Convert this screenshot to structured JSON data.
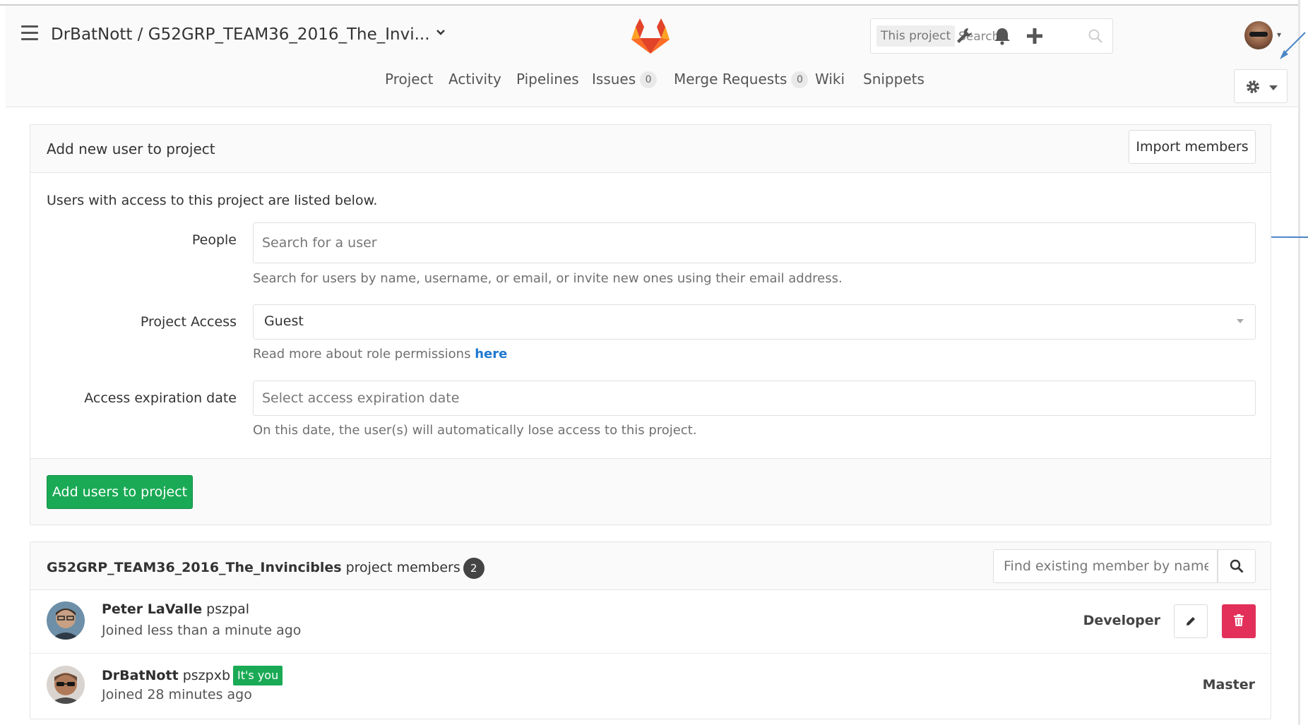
{
  "header": {
    "project_path": "DrBatNott / G52GRP_TEAM36_2016_The_Invi...",
    "search_scope": "This project",
    "search_placeholder": "Search"
  },
  "nav": {
    "items": [
      {
        "label": "Project"
      },
      {
        "label": "Activity"
      },
      {
        "label": "Pipelines"
      },
      {
        "label": "Issues",
        "count": "0"
      },
      {
        "label": "Merge Requests",
        "count": "0"
      },
      {
        "label": "Wiki"
      },
      {
        "label": "Snippets"
      }
    ]
  },
  "add_panel": {
    "title": "Add new user to project",
    "import_button": "Import members",
    "intro": "Users with access to this project are listed below.",
    "people_label": "People",
    "people_placeholder": "Search for a user",
    "people_help": "Search for users by name, username, or email, or invite new ones using their email address.",
    "access_label": "Project Access",
    "access_value": "Guest",
    "access_help": "Read more about role permissions",
    "access_help_link": "here",
    "expiry_label": "Access expiration date",
    "expiry_placeholder": "Select access expiration date",
    "expiry_help": "On this date, the user(s) will automatically lose access to this project.",
    "submit_button": "Add users to project"
  },
  "members_panel": {
    "project_name": "G52GRP_TEAM36_2016_The_Invincibles",
    "title_suffix": "project members",
    "count": "2",
    "find_placeholder": "Find existing member by name",
    "members": [
      {
        "name": "Peter LaValle",
        "username": "pszpal",
        "joined": "Joined less than a minute ago",
        "role": "Developer"
      },
      {
        "name": "DrBatNott",
        "username": "pszpxb",
        "badge": "It's you",
        "joined": "Joined 28 minutes ago",
        "role": "Master"
      }
    ]
  },
  "colors": {
    "accent_green": "#1aaa55",
    "danger_red": "#e2305a",
    "link_blue": "#1f78d1",
    "annotation_arrow": "#4a86c5"
  },
  "icons": [
    "hamburger-icon",
    "gitlab-logo-icon",
    "search-icon",
    "wrench-icon",
    "bell-icon",
    "plus-icon",
    "gear-icon",
    "pencil-icon",
    "trash-icon"
  ]
}
